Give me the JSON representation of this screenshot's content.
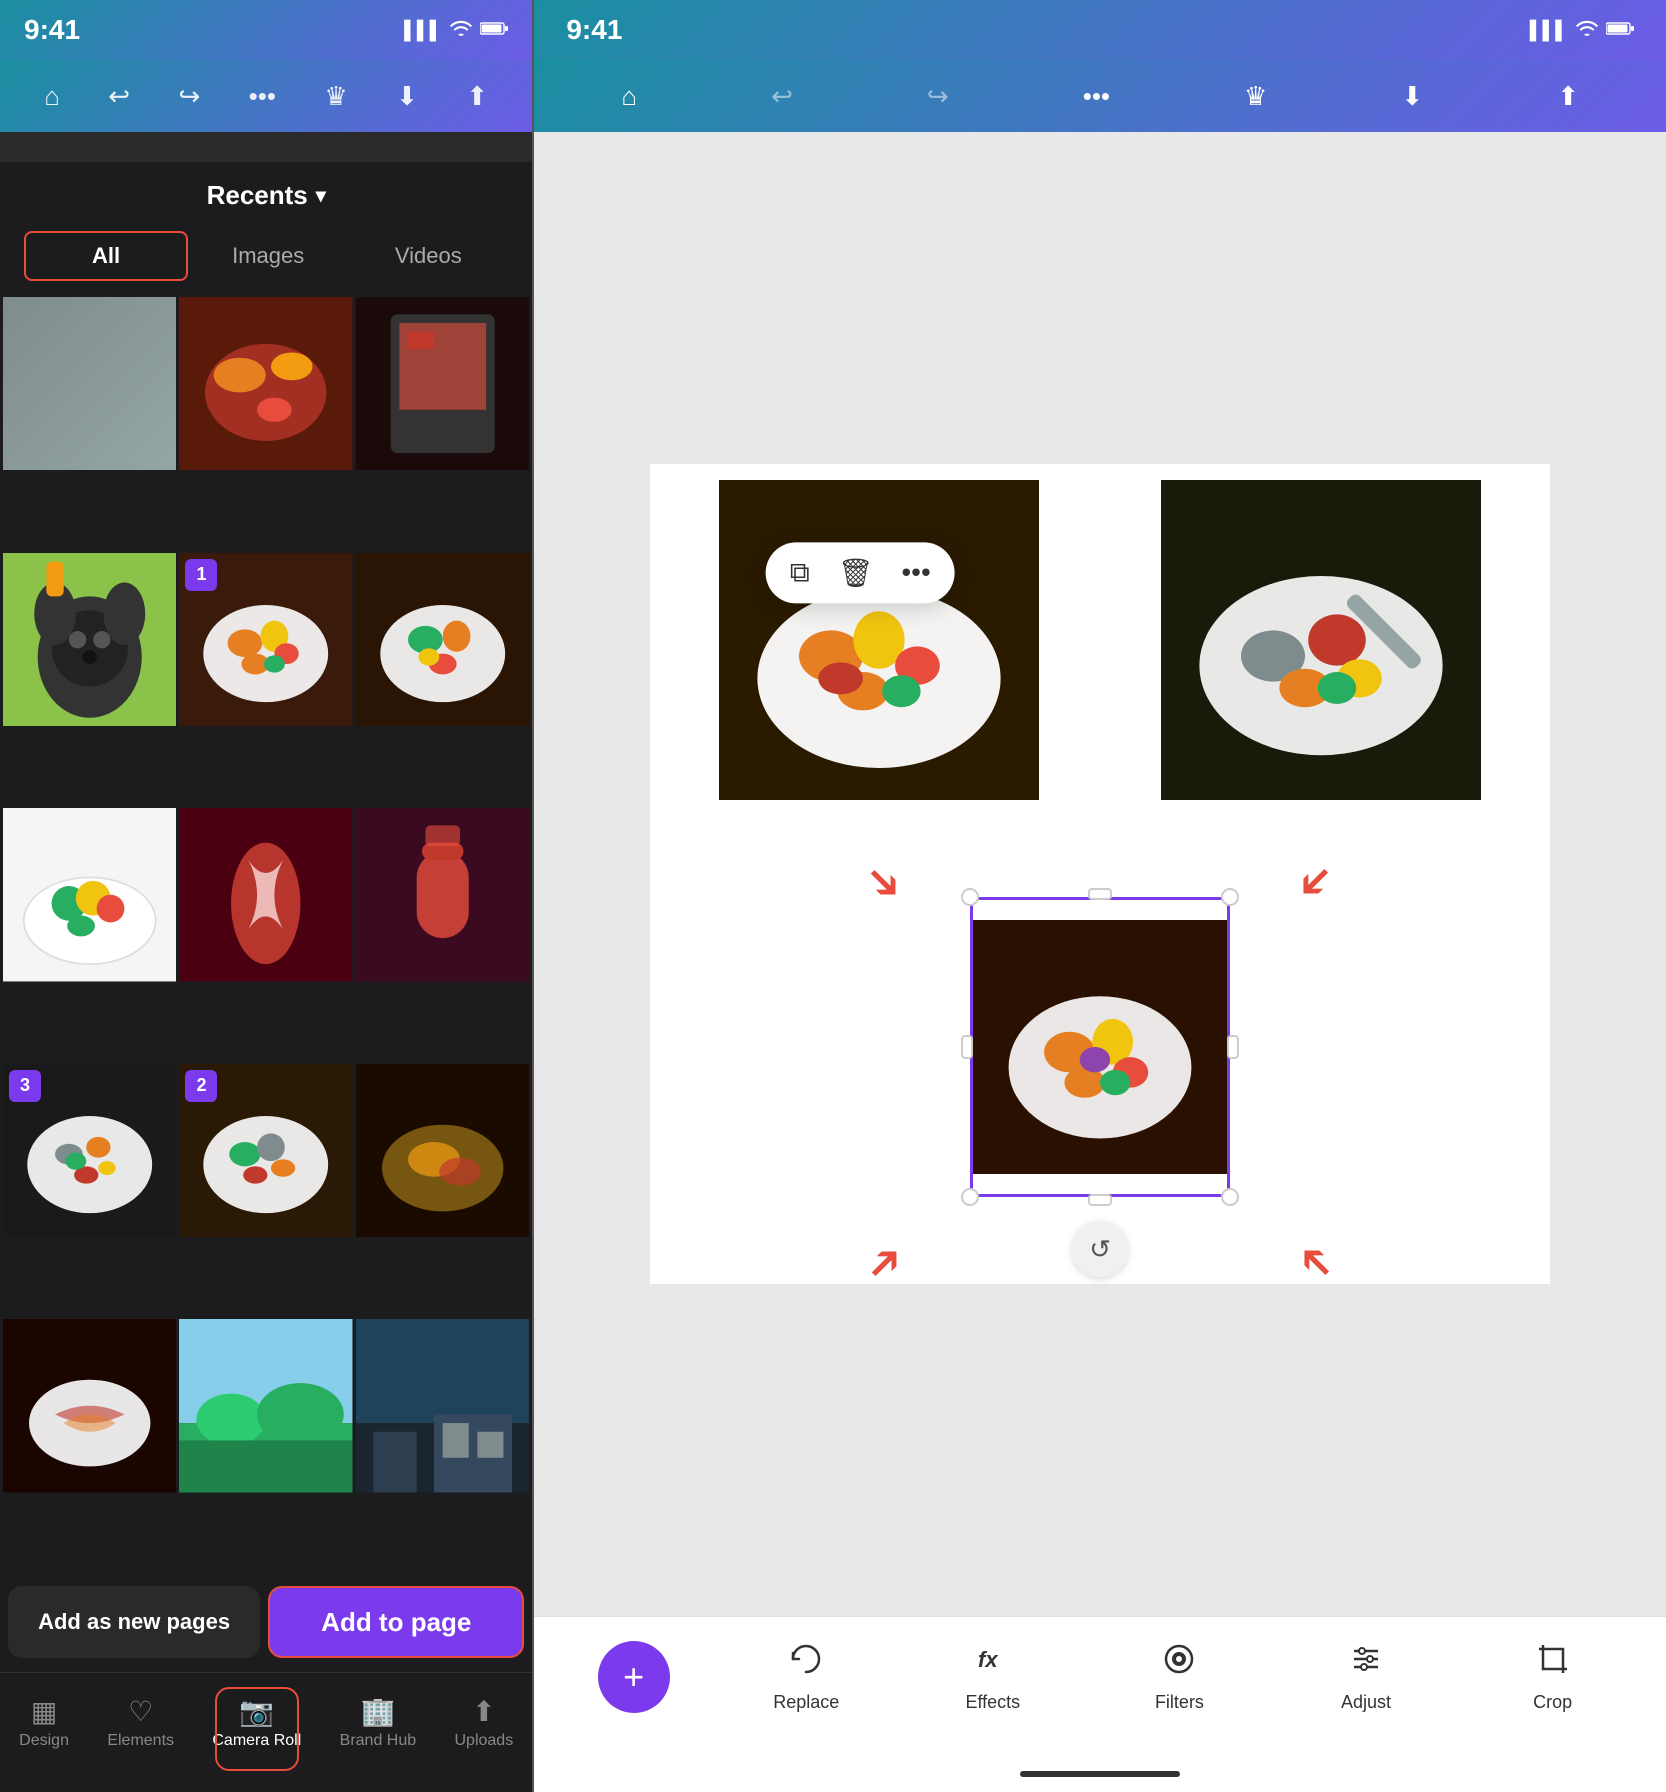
{
  "left": {
    "status_bar": {
      "time": "9:41",
      "signal": "▌▌▌",
      "wifi": "wifi",
      "battery": "🔋"
    },
    "toolbar": {
      "home_icon": "⌂",
      "undo_icon": "↩",
      "redo_icon": "↪",
      "more_icon": "•••",
      "crown_icon": "♛",
      "download_icon": "⬇",
      "share_icon": "⬆"
    },
    "recents_label": "Recents",
    "chevron": "▾",
    "filter_tabs": [
      {
        "label": "All",
        "active": true
      },
      {
        "label": "Images",
        "active": false
      },
      {
        "label": "Videos",
        "active": false
      }
    ],
    "photos": [
      {
        "id": "p1",
        "badge": null,
        "color_class": "photo-grey"
      },
      {
        "id": "p2",
        "badge": null,
        "color_class": "photo-fruit1"
      },
      {
        "id": "p3",
        "badge": null,
        "color_class": "photo-fruit2"
      },
      {
        "id": "p4",
        "badge": null,
        "color_class": "photo-dog"
      },
      {
        "id": "p5",
        "badge": "1",
        "color_class": "photo-fruit3"
      },
      {
        "id": "p6",
        "badge": null,
        "color_class": "photo-fruit4"
      },
      {
        "id": "p7",
        "badge": null,
        "color_class": "photo-fruit5"
      },
      {
        "id": "p8",
        "badge": null,
        "color_class": "photo-candy"
      },
      {
        "id": "p9",
        "badge": null,
        "color_class": "photo-drink"
      },
      {
        "id": "p10",
        "badge": "3",
        "color_class": "photo-dark1"
      },
      {
        "id": "p11",
        "badge": "2",
        "color_class": "photo-dark2"
      },
      {
        "id": "p12",
        "badge": null,
        "color_class": "photo-food1"
      },
      {
        "id": "p13",
        "badge": null,
        "color_class": "photo-food2"
      },
      {
        "id": "p14",
        "badge": null,
        "color_class": "photo-nature"
      },
      {
        "id": "p15",
        "badge": null,
        "color_class": "photo-interior"
      }
    ],
    "btn_add_pages": "Add as new pages",
    "btn_add_to_page": "Add to page",
    "nav_items": [
      {
        "id": "design",
        "icon": "▦",
        "label": "Design",
        "active": false
      },
      {
        "id": "elements",
        "icon": "♡",
        "label": "Elements",
        "active": false
      },
      {
        "id": "camera_roll",
        "icon": "📷",
        "label": "Camera Roll",
        "active": true
      },
      {
        "id": "brand_hub",
        "icon": "🏢",
        "label": "Brand Hub",
        "active": false
      },
      {
        "id": "uploads",
        "icon": "⬆",
        "label": "Uploads",
        "active": false
      }
    ]
  },
  "right": {
    "status_bar": {
      "time": "9:41",
      "signal": "▌▌▌",
      "wifi": "wifi",
      "battery": "🔋"
    },
    "toolbar": {
      "home_icon": "⌂",
      "undo_icon": "↩",
      "redo_icon": "↪",
      "more_icon": "•••",
      "crown_icon": "♛",
      "download_icon": "⬇",
      "share_icon": "⬆"
    },
    "context_menu_buttons": [
      {
        "icon": "⧉",
        "label": "copy"
      },
      {
        "icon": "🗑",
        "label": "delete"
      },
      {
        "icon": "•••",
        "label": "more"
      }
    ],
    "rotate_icon": "↺",
    "bottom_tools": [
      {
        "id": "replace",
        "icon": "↺",
        "label": "Replace"
      },
      {
        "id": "effects",
        "icon": "fx",
        "label": "Effects"
      },
      {
        "id": "filters",
        "icon": "◉",
        "label": "Filters"
      },
      {
        "id": "adjust",
        "icon": "⚙",
        "label": "Adjust"
      },
      {
        "id": "crop",
        "icon": "⊡",
        "label": "Crop"
      }
    ],
    "plus_icon": "+",
    "home_indicator": ""
  }
}
